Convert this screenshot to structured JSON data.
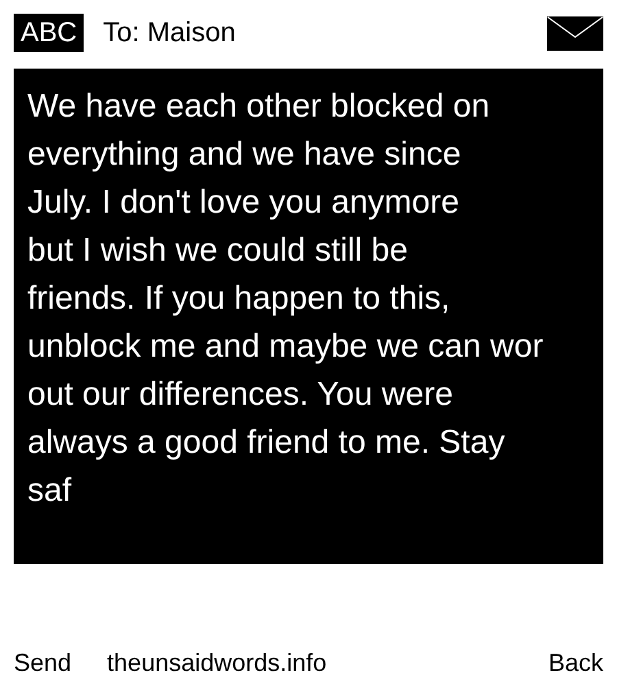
{
  "header": {
    "input_mode": "ABC",
    "recipient": "To: Maison"
  },
  "message": {
    "text": "We have each other blocked on\neverything and we have since\nJuly. I don't love you anymore\nbut I wish we could still be\nfriends. If you happen to this,\nunblock me and maybe we can wor\nout our differences. You were\nalways a good friend to me. Stay\nsaf"
  },
  "footer": {
    "left": "Send",
    "center": "theunsaidwords.info",
    "right": "Back"
  }
}
